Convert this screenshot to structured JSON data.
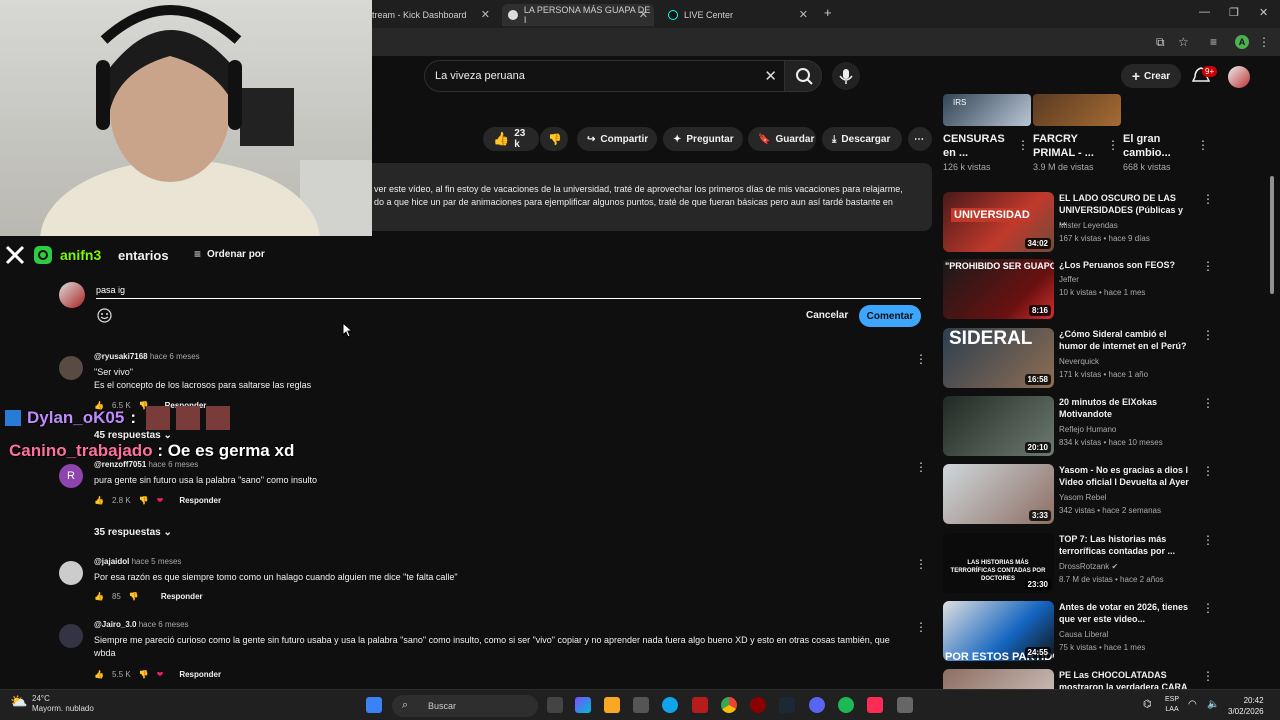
{
  "browser": {
    "tabs": [
      {
        "label": "tream - Kick Dashboard"
      },
      {
        "label": "LA PERSONA MÁS GUAPA DE I"
      },
      {
        "label": "LIVE Center"
      }
    ],
    "new_tab": "+",
    "close": "✕"
  },
  "header": {
    "search_value": "La viveza peruana",
    "create_label": "Crear",
    "notif_count": "9+"
  },
  "actions": {
    "likes": "23 k",
    "share": "Compartir",
    "ask": "Preguntar",
    "save": "Guardar",
    "download": "Descargar"
  },
  "description": {
    "line1": "ver este vídeo, al fin estoy de vacaciones de la universidad, traté de aprovechar los primeros días de mis vacaciones para relajarme,",
    "line2": "do a que hice un par de animaciones para ejemplificar algunos puntos, traté de que fueran básicas pero aun así tardé bastante en"
  },
  "overlay": {
    "handle": "anifn3"
  },
  "comments_section": {
    "title": "entarios",
    "sort_label": "Ordenar por",
    "input_value": "pasa ig",
    "cancel_label": "Cancelar",
    "submit_label": "Comentar"
  },
  "comments": [
    {
      "user": "@ryusaki7168",
      "time": "hace 6 meses",
      "lines": [
        "\"Ser vivo\"",
        "Es el concepto de los lacrosos para saltarse las reglas"
      ],
      "likes": "6.5 K",
      "reply": "Responder",
      "replies": "45 respuestas"
    },
    {
      "user": "@renzoff7051",
      "time": "hace 6 meses",
      "lines": [
        "pura gente sin futuro usa la palabra \"sano\" como insulto"
      ],
      "likes": "2.8 K",
      "reply": "Responder",
      "replies": "35 respuestas",
      "avatar_letter": "R"
    },
    {
      "user": "@jajaidol",
      "time": "hace 5 meses",
      "lines": [
        "Por esa razón es que siempre tomo como un halago cuando alguien me dice \"te falta calle\""
      ],
      "likes": "85",
      "reply": "Responder"
    },
    {
      "user": "@Jairo_3.0",
      "time": "hace 6 meses",
      "lines": [
        "Siempre me pareció curioso como la gente sin futuro usaba y usa la palabra \"sano\" como insulto, como si ser \"vivo\" copiar y no aprender nada fuera algo bueno XD y esto en otras cosas también, que",
        "wbda"
      ],
      "likes": "5.5 K",
      "reply": "Responder"
    }
  ],
  "chat": [
    {
      "user": "Dylan_oK05",
      "sep": ":",
      "message": ""
    },
    {
      "user": "Canino_trabajado",
      "sep": " : ",
      "message": "Oe es germa xd"
    }
  ],
  "shorts": [
    {
      "title": "CENSURAS en ...",
      "views": "126 k vistas",
      "thumb_text": "IRS"
    },
    {
      "title": "FARCRY PRIMAL - ...",
      "views": "3.9 M de vistas"
    },
    {
      "title": "El gran cambio...",
      "views": "668 k vistas"
    }
  ],
  "recommendations": [
    {
      "title": "EL LADO OSCURO DE LAS UNIVERSIDADES (Públicas y ...",
      "channel": "Mister Leyendas",
      "stats": "167 k vistas • hace 9 días",
      "duration": "34:02",
      "thumb_text": "UNIVERSIDAD"
    },
    {
      "title": "¿Los Peruanos son FEOS?",
      "channel": "Jeffer",
      "stats": "10 k vistas • hace 1 mes",
      "duration": "8:16",
      "thumb_text": "\"PROHIBIDO SER GUAPO\""
    },
    {
      "title": "¿Cómo Sideral cambió el humor de internet en el Perú?",
      "channel": "Neverquick",
      "stats": "171 k vistas • hace 1 año",
      "duration": "16:58",
      "thumb_text": "SIDERAL"
    },
    {
      "title": "20 minutos de ElXokas Motivandote",
      "channel": "Reflejo Humano",
      "stats": "834 k vistas • hace 10 meses",
      "duration": "20:10"
    },
    {
      "title": "Yasom - No es gracias a dios l Video oficial l Devuelta al Ayer",
      "channel": "Yasom Rebel",
      "stats": "342 vistas • hace 2 semanas",
      "duration": "3:33"
    },
    {
      "title": "TOP 7: Las historias más terroríficas contadas por ...",
      "channel": "DrossRotzank",
      "stats": "8.7 M de vistas • hace 2 años",
      "duration": "23:30",
      "thumb_text": "LAS HISTORIAS MÁS TERRORÍFICAS CONTADAS POR DOCTORES"
    },
    {
      "title": "Antes de votar en 2026, tienes que ver este video...",
      "channel": "Causa Liberal",
      "stats": "75 k vistas • hace 1 mes",
      "duration": "24:55",
      "thumb_text": "POR ESTOS PARTIDOS"
    },
    {
      "title": "PE Las CHOCOLATADAS mostraron la verdadera CARA",
      "channel": "",
      "stats": "",
      "duration": ""
    }
  ],
  "taskbar": {
    "temp": "24°C",
    "weather": "Mayorm. nublado",
    "search": "Buscar",
    "lang1": "ESP",
    "lang2": "LAA",
    "time": "20:42",
    "date": "3/02/2026"
  }
}
